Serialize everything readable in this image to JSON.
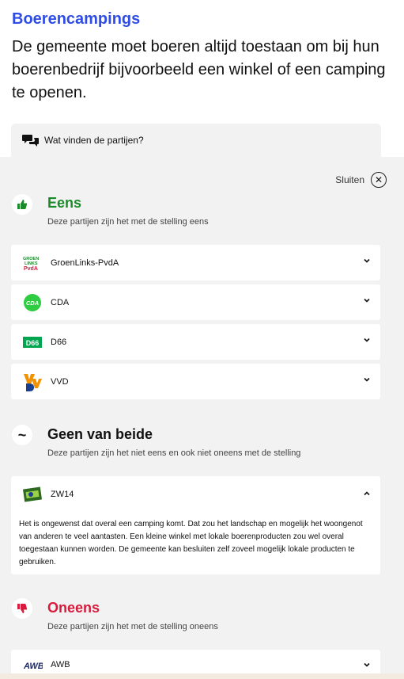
{
  "topic": "Boerencampings",
  "statement": "De gemeente moet boeren altijd toestaan om bij hun boerenbedrijf bijvoorbeeld een winkel of een camping te openen.",
  "tab_label": "Wat vinden de partijen?",
  "close_label": "Sluiten",
  "sections": {
    "agree": {
      "title": "Eens",
      "subtitle": "Deze partijen zijn het met de stelling eens",
      "color": "#1a8a2a",
      "parties": [
        {
          "name": "GroenLinks-PvdA",
          "logo_text": "GroenLinks PvdA"
        },
        {
          "name": "CDA",
          "logo_text": "CDA"
        },
        {
          "name": "D66",
          "logo_text": "D66"
        },
        {
          "name": "VVD",
          "logo_text": "VVD"
        }
      ]
    },
    "neutral": {
      "title": "Geen van beide",
      "subtitle": "Deze partijen zijn het niet eens en ook niet oneens met de stelling",
      "color": "#111111",
      "party": {
        "name": "ZW14",
        "explanation": "Het is ongewenst dat overal een camping komt. Dat zou het landschap en mogelijk het woongenot van anderen te veel aantasten. Een kleine winkel met lokale boerenproducten zou wel overal toegestaan kunnen worden. De gemeente kan besluiten zelf zoveel mogelijk lokale producten te gebruiken."
      }
    },
    "disagree": {
      "title": "Oneens",
      "subtitle": "Deze partijen zijn het met de stelling oneens",
      "color": "#d81b3c",
      "parties": [
        {
          "name": "AWB",
          "logo_text": "AWB"
        }
      ]
    }
  }
}
